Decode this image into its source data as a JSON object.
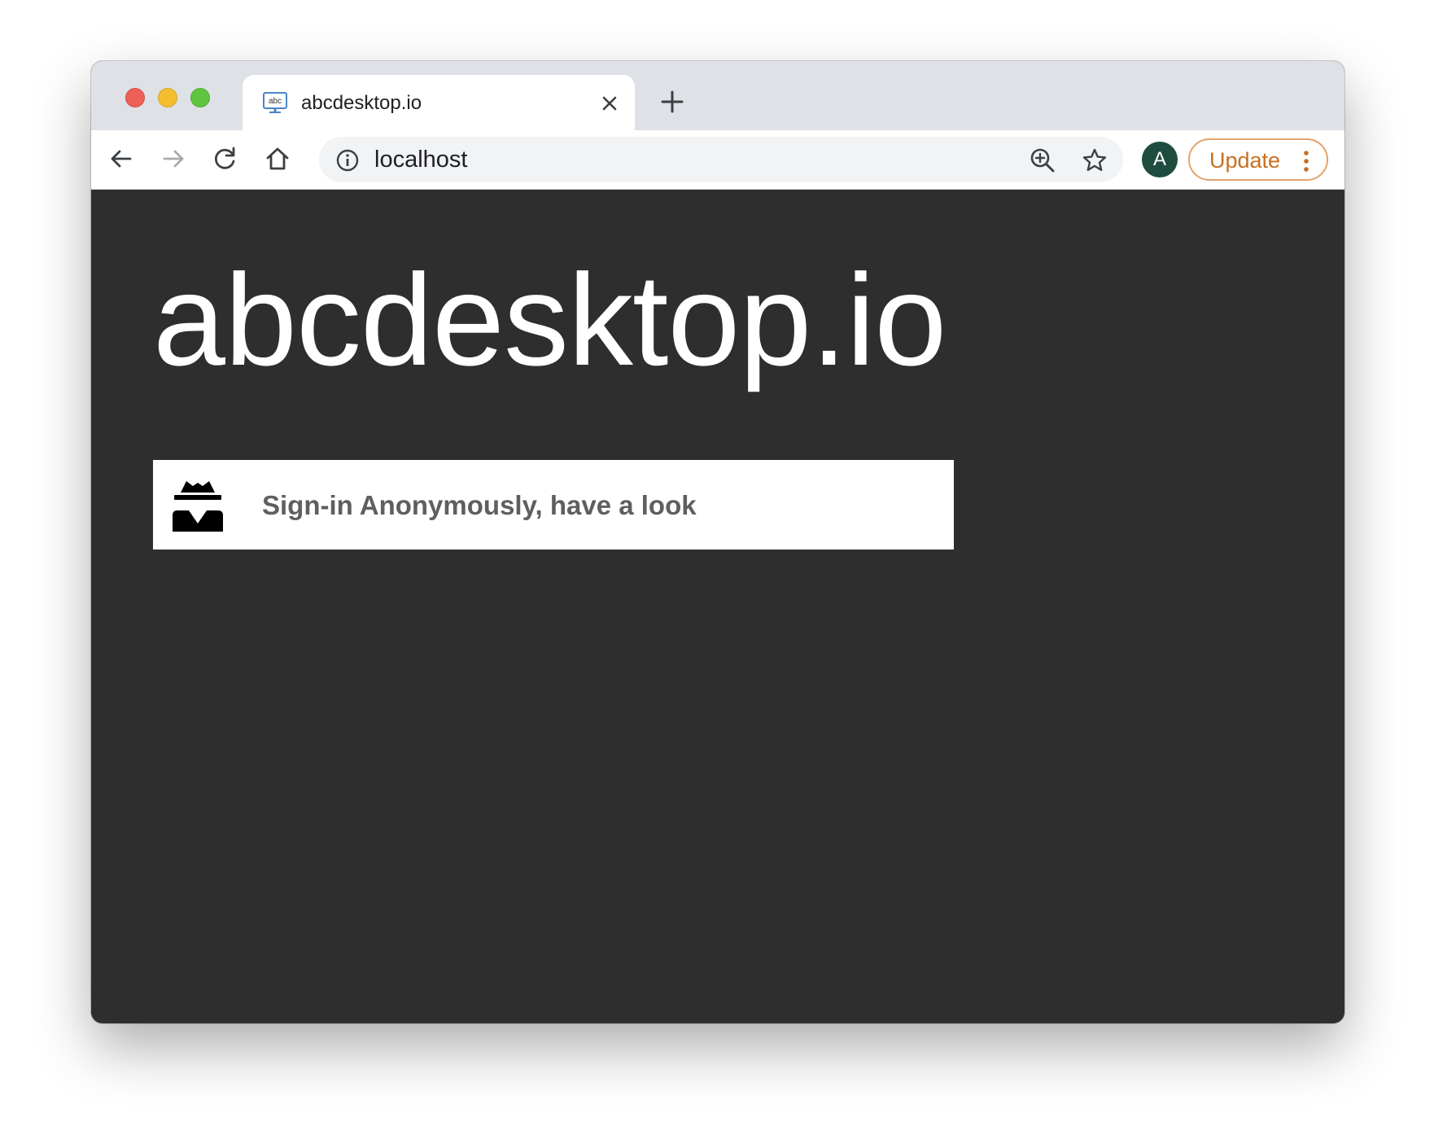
{
  "window": {
    "controls": [
      "close",
      "minimize",
      "zoom"
    ]
  },
  "tab": {
    "favicon_text": "abc",
    "title": "abcdesktop.io"
  },
  "toolbar": {
    "url": "localhost",
    "avatar_initial": "A",
    "update_label": "Update"
  },
  "page": {
    "brand_title": "abcdesktop.io",
    "signin_label": "Sign-in Anonymously, have a look"
  },
  "colors": {
    "page_background": "#2e2e2e",
    "tabstrip": "#dee1e6",
    "update_accent": "#c96f1f",
    "avatar": "#1e4d40"
  }
}
